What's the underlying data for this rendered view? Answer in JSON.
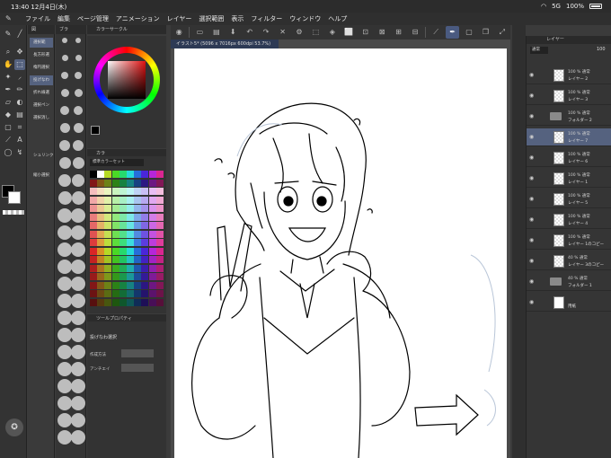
{
  "status": {
    "time": "13:40",
    "date": "12月4日(木)",
    "network": "5G",
    "battery": "100%"
  },
  "menu": [
    "ファイル",
    "編集",
    "ページ管理",
    "アニメーション",
    "レイヤー",
    "選択範囲",
    "表示",
    "フィルター",
    "ウィンドウ",
    "ヘルプ"
  ],
  "panels": {
    "subtool_tab": "図",
    "brush_tab": "ブラ",
    "color_circle_title": "カラーサークル",
    "swatch_tab": "カラ",
    "swatch_set": "標準カラーセット",
    "tool_property_title": "ツールプロパティ",
    "tool_property_name": "投げなわ選択",
    "creation_method_label": "作成方法",
    "antialias_label": "アンチエイ",
    "layer_title": "レイヤー",
    "blend_mode": "通常",
    "opacity": "100"
  },
  "subtools": [
    "選択範",
    "長方形選",
    "楕円選択",
    "投げなわ",
    "折れ線選",
    "選択ペン",
    "選択消し",
    "シュリンク",
    "縮小選択"
  ],
  "document": {
    "tab_label": "イラスト5* (5096 x 7016px 600dpi 53.7%)"
  },
  "layers": [
    {
      "l1": "100 % 通常",
      "l2": "レイヤー 2",
      "type": "layer"
    },
    {
      "l1": "100 % 通常",
      "l2": "レイヤー 3",
      "type": "layer"
    },
    {
      "l1": "100 % 通常",
      "l2": "フォルダー 2",
      "type": "folder"
    },
    {
      "l1": "100 % 通常",
      "l2": "レイヤー 7",
      "type": "layer",
      "selected": true
    },
    {
      "l1": "100 % 通常",
      "l2": "レイヤー 6",
      "type": "layer"
    },
    {
      "l1": "100 % 通常",
      "l2": "レイヤー 1",
      "type": "layer"
    },
    {
      "l1": "100 % 通常",
      "l2": "レイヤー 5",
      "type": "layer"
    },
    {
      "l1": "100 % 通常",
      "l2": "レイヤー 4",
      "type": "layer"
    },
    {
      "l1": "100 % 通常",
      "l2": "レイヤー 1のコピー",
      "type": "layer"
    },
    {
      "l1": "40 % 通常",
      "l2": "レイヤー 3のコピー",
      "type": "layer"
    },
    {
      "l1": "40 % 通常",
      "l2": "フォルダー 1",
      "type": "folder"
    },
    {
      "l1": "",
      "l2": "用紙",
      "type": "paper"
    }
  ],
  "colors": {
    "accent": "#55627f",
    "foreground": "#000000",
    "background": "#ffffff"
  }
}
